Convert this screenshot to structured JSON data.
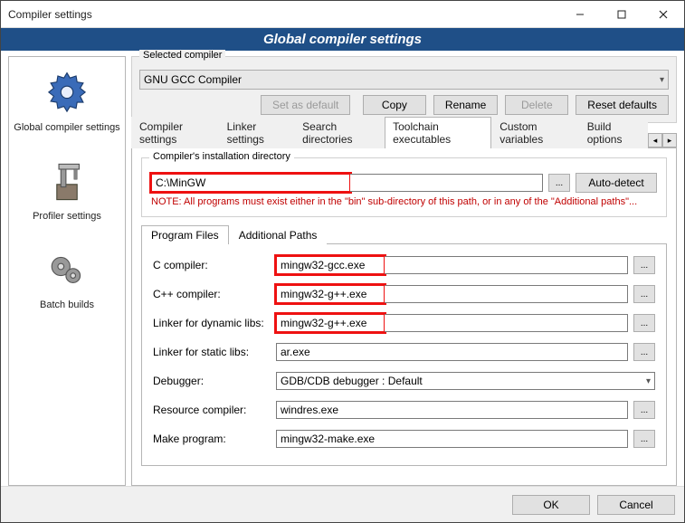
{
  "window": {
    "title": "Compiler settings"
  },
  "header": {
    "title": "Global compiler settings"
  },
  "sidebar": {
    "items": [
      {
        "label": "Global compiler settings"
      },
      {
        "label": "Profiler settings"
      },
      {
        "label": "Batch builds"
      }
    ]
  },
  "selected_compiler": {
    "groupLabel": "Selected compiler",
    "value": "GNU GCC Compiler",
    "buttons": {
      "setDefault": "Set as default",
      "copy": "Copy",
      "rename": "Rename",
      "delete": "Delete",
      "reset": "Reset defaults"
    }
  },
  "tabs": {
    "items": [
      "Compiler settings",
      "Linker settings",
      "Search directories",
      "Toolchain executables",
      "Custom variables",
      "Build options"
    ],
    "activeIndex": 3
  },
  "install_dir": {
    "groupLabel": "Compiler's installation directory",
    "value": "C:\\MinGW",
    "autodetect": "Auto-detect",
    "note": "NOTE: All programs must exist either in the \"bin\" sub-directory of this path, or in any of the \"Additional paths\"..."
  },
  "subtabs": {
    "items": [
      "Program Files",
      "Additional Paths"
    ],
    "activeIndex": 0
  },
  "programs": {
    "rows": [
      {
        "label": "C compiler:",
        "value": "mingw32-gcc.exe",
        "type": "input",
        "highlight": true
      },
      {
        "label": "C++ compiler:",
        "value": "mingw32-g++.exe",
        "type": "input",
        "highlight": true
      },
      {
        "label": "Linker for dynamic libs:",
        "value": "mingw32-g++.exe",
        "type": "input",
        "highlight": true
      },
      {
        "label": "Linker for static libs:",
        "value": "ar.exe",
        "type": "input"
      },
      {
        "label": "Debugger:",
        "value": "GDB/CDB debugger : Default",
        "type": "select"
      },
      {
        "label": "Resource compiler:",
        "value": "windres.exe",
        "type": "input"
      },
      {
        "label": "Make program:",
        "value": "mingw32-make.exe",
        "type": "input"
      }
    ]
  },
  "footer": {
    "ok": "OK",
    "cancel": "Cancel"
  }
}
